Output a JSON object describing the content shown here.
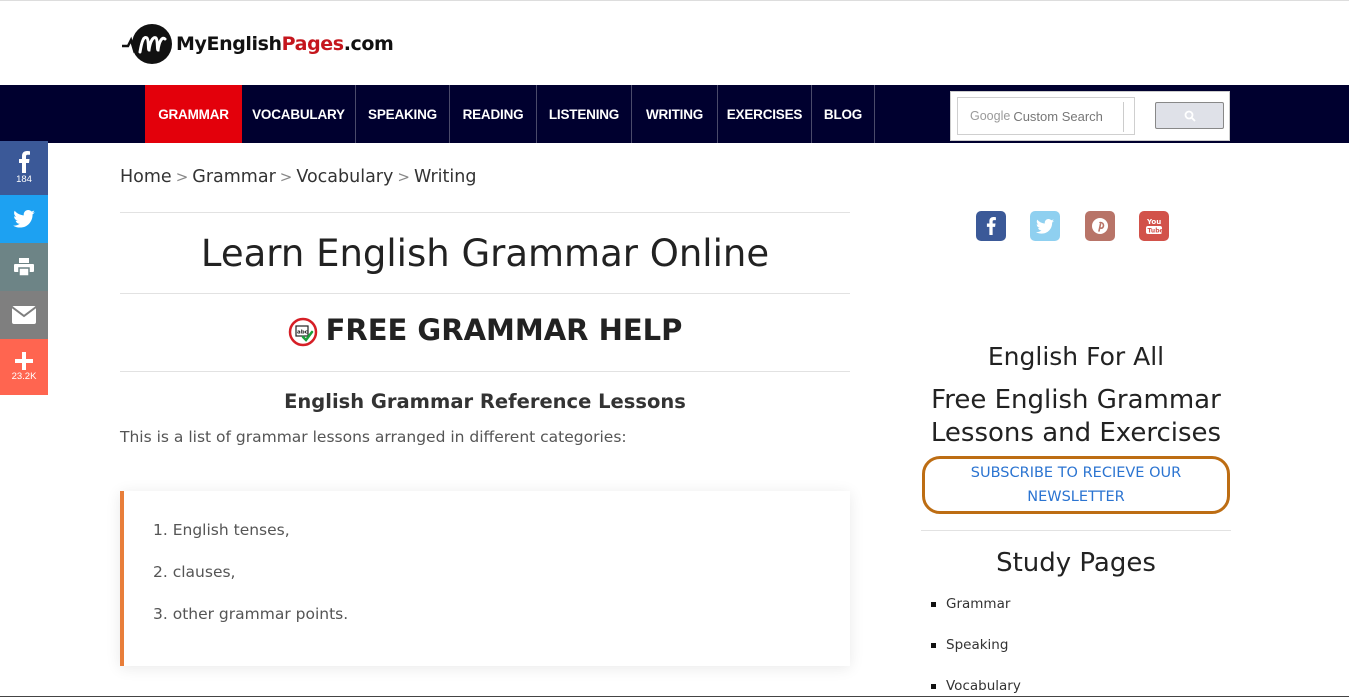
{
  "logo": {
    "text_main": "MyEnglish",
    "text_accent": "Pages",
    "text_suffix": ".com",
    "brand_color": "#c5161d"
  },
  "nav": {
    "items": [
      {
        "label": "GRAMMAR",
        "active": true
      },
      {
        "label": "VOCABULARY"
      },
      {
        "label": "SPEAKING"
      },
      {
        "label": "READING"
      },
      {
        "label": "LISTENING"
      },
      {
        "label": "WRITING"
      },
      {
        "label": "EXERCISES"
      },
      {
        "label": "BLOG"
      }
    ],
    "active_color": "#e3000b",
    "bar_color": "#00002f"
  },
  "search": {
    "google_label": "Google",
    "placeholder": "Custom Search",
    "button_icon": "search-icon"
  },
  "share": {
    "facebook": {
      "icon": "facebook-icon",
      "count": "184",
      "color": "#3b5998"
    },
    "twitter": {
      "icon": "twitter-icon",
      "color": "#1da1f2"
    },
    "print": {
      "icon": "print-icon",
      "color": "#6d8486"
    },
    "email": {
      "icon": "email-icon",
      "color": "#7f7f7f"
    },
    "more": {
      "icon": "plus-icon",
      "count": "23.2K",
      "color": "#ff6550"
    }
  },
  "breadcrumb": {
    "items": [
      "Home",
      "Grammar",
      "Vocabulary",
      "Writing"
    ],
    "separator": ">"
  },
  "main": {
    "title": "Learn English Grammar Online",
    "section_title": "FREE GRAMMAR HELP",
    "subheading": "English Grammar Reference Lessons",
    "intro": "This is a list of grammar lessons arranged in different categories:",
    "list": [
      "1. English tenses,",
      "2. clauses,",
      "3. other grammar points."
    ]
  },
  "sidebar": {
    "social_icons": [
      "facebook-icon",
      "twitter-icon",
      "pinterest-icon",
      "youtube-icon"
    ],
    "heading1": "English For All",
    "heading2_line1": "Free English Grammar",
    "heading2_line2": "Lessons and Exercises",
    "subscribe_label": "SUBSCRIBE TO RECIEVE OUR NEWSLETTER",
    "study_title": "Study Pages",
    "study_items": [
      "Grammar",
      "Speaking",
      "Vocabulary"
    ]
  }
}
